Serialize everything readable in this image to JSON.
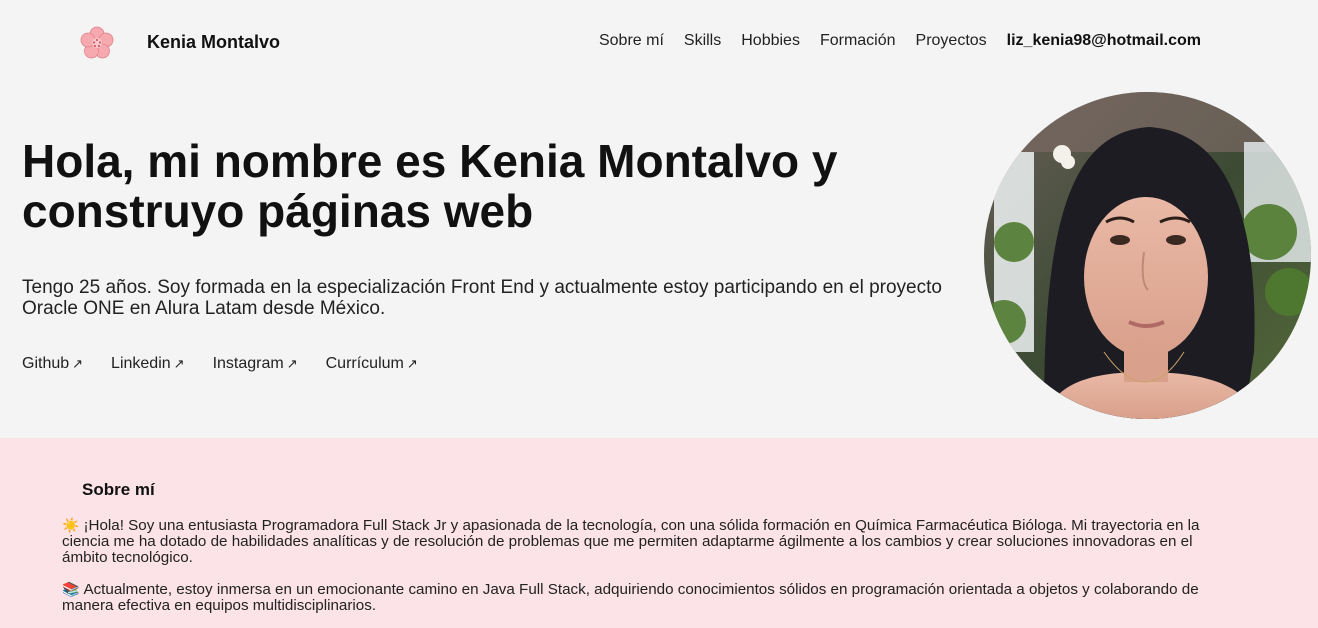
{
  "header": {
    "logo_icon": "flower-icon",
    "brand": "Kenia Montalvo",
    "nav": [
      {
        "label": "Sobre mí"
      },
      {
        "label": "Skills"
      },
      {
        "label": "Hobbies"
      },
      {
        "label": "Formación"
      },
      {
        "label": "Proyectos"
      }
    ],
    "email": "liz_kenia98@hotmail.com"
  },
  "hero": {
    "title": "Hola, mi nombre es Kenia Montalvo y construyo páginas web",
    "text": "Tengo 25 años. Soy formada en la especialización Front End y actualmente estoy participando en el proyecto Oracle ONE en Alura Latam desde México.",
    "links": [
      {
        "label": "Github",
        "arrow": "↗"
      },
      {
        "label": "Linkedin",
        "arrow": "↗"
      },
      {
        "label": "Instagram",
        "arrow": "↗"
      },
      {
        "label": "Currículum",
        "arrow": "↗"
      }
    ]
  },
  "about": {
    "title": "Sobre mí",
    "p1_emoji": "☀️",
    "p1": "¡Hola! Soy una entusiasta Programadora Full Stack Jr y apasionada de la tecnología, con una sólida formación en Química Farmacéutica Bióloga. Mi trayectoria en la ciencia me ha dotado de habilidades analíticas y de resolución de problemas que me permiten adaptarme ágilmente a los cambios y crear soluciones innovadoras en el ámbito tecnológico.",
    "p2_emoji": "📚",
    "p2": "Actualmente, estoy inmersa en un emocionante camino en Java Full Stack, adquiriendo conocimientos sólidos en programación orientada a objetos y colaborando de manera efectiva en equipos multidisciplinarios."
  },
  "colors": {
    "page_bg": "#f4f4f4",
    "about_bg": "#fbe3e7",
    "flower": "#f2a0a8"
  }
}
